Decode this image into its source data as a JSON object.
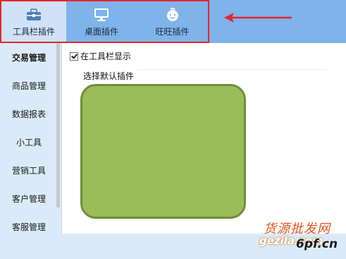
{
  "toolbar": {
    "tabs": [
      {
        "label": "工具栏插件",
        "icon": "toolbox-icon",
        "selected": true
      },
      {
        "label": "桌面插件",
        "icon": "monitor-icon",
        "selected": false
      },
      {
        "label": "旺旺插件",
        "icon": "wangwang-face-icon",
        "selected": false
      }
    ],
    "highlight_color": "#e6262a"
  },
  "sidebar": {
    "items": [
      {
        "label": "交易管理",
        "active": true
      },
      {
        "label": "商品管理"
      },
      {
        "label": "数据报表"
      },
      {
        "label": "小工具"
      },
      {
        "label": "营销工具"
      },
      {
        "label": "客户管理"
      },
      {
        "label": "客服管理"
      }
    ]
  },
  "main": {
    "show_in_toolbar_label": "在工具栏显示",
    "show_in_toolbar_checked": true,
    "default_plugin_label": "选择默认插件",
    "preview_color": "#9cbc5a"
  },
  "watermark": {
    "line1": "货源批发网",
    "line2": "gezila.com",
    "line3": "6pf.cn"
  }
}
